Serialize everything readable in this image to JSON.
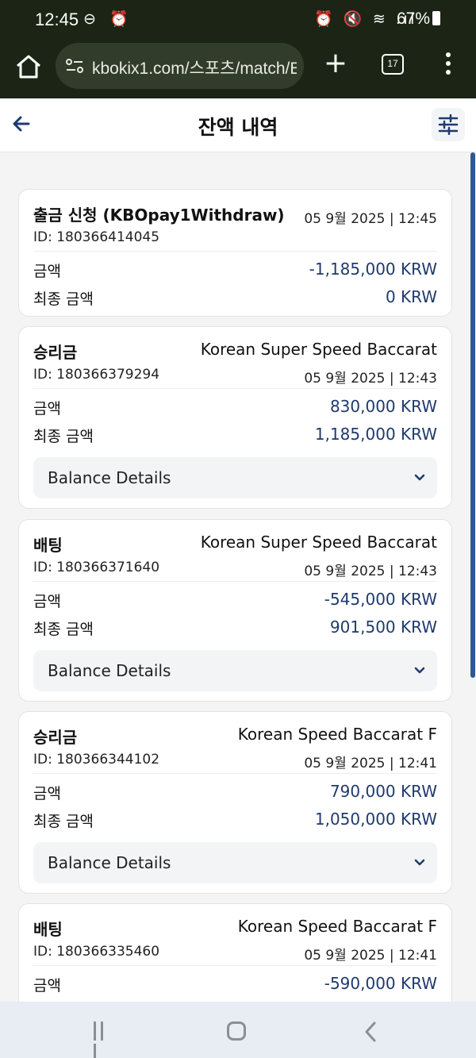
{
  "status_bar": {
    "time": "12:45",
    "left_icons": "⊖ ⏰",
    "right_icons": "⏰ 🔇 ≋ .ıl",
    "battery": "67%"
  },
  "browser": {
    "url": "kbokix1.com/스포츠/match/E",
    "tab_count": "17"
  },
  "header": {
    "title": "잔액 내역"
  },
  "transactions": [
    {
      "type": "출금 신청 (KBOpay1Withdraw)",
      "game": "",
      "id_text": "ID: 180366414045",
      "datetime": "05 9월 2025 | 12:45",
      "amount_label": "금액",
      "amount": "-1,185,000 KRW",
      "final_label": "최종 금액",
      "final_amount": "0 KRW",
      "details_label": ""
    },
    {
      "type": "승리금",
      "game": "Korean Super Speed Baccarat",
      "id_text": "ID: 180366379294",
      "datetime": "05 9월 2025 | 12:43",
      "amount_label": "금액",
      "amount": "830,000 KRW",
      "final_label": "최종 금액",
      "final_amount": "1,185,000 KRW",
      "details_label": "Balance Details"
    },
    {
      "type": "배팅",
      "game": "Korean Super Speed Baccarat",
      "id_text": "ID: 180366371640",
      "datetime": "05 9월 2025 | 12:43",
      "amount_label": "금액",
      "amount": "-545,000 KRW",
      "final_label": "최종 금액",
      "final_amount": "901,500 KRW",
      "details_label": "Balance Details"
    },
    {
      "type": "승리금",
      "game": "Korean Speed Baccarat F",
      "id_text": "ID: 180366344102",
      "datetime": "05 9월 2025 | 12:41",
      "amount_label": "금액",
      "amount": "790,000 KRW",
      "final_label": "최종 금액",
      "final_amount": "1,050,000 KRW",
      "details_label": "Balance Details"
    },
    {
      "type": "배팅",
      "game": "Korean Speed Baccarat F",
      "id_text": "ID: 180366335460",
      "datetime": "05 9월 2025 | 12:41",
      "amount_label": "금액",
      "amount": "-590,000 KRW",
      "final_label": "",
      "final_amount": "",
      "details_label": ""
    }
  ],
  "colors": {
    "chrome_bg": "#1c2515",
    "amount_text": "#1f3a6e",
    "scrollbar": "#2c5a97",
    "navbar_bg": "#e8ecf3"
  }
}
